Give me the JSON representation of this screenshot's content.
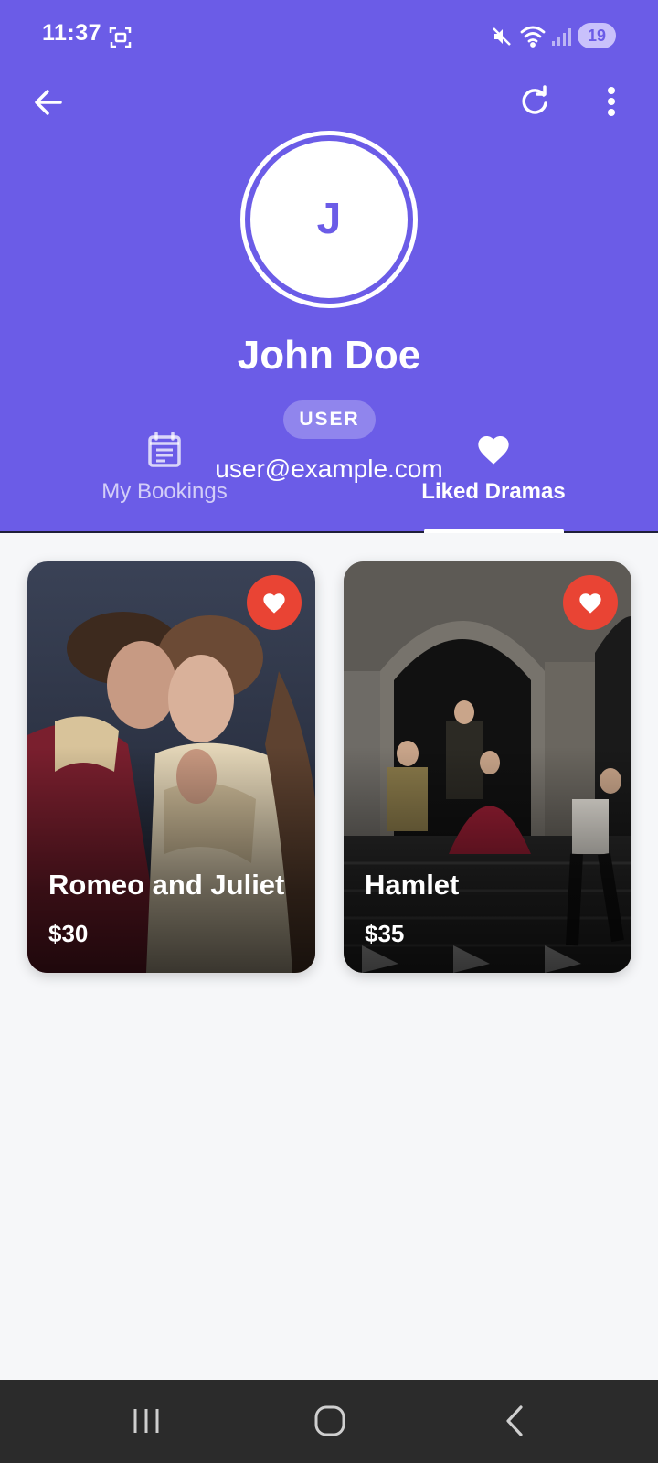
{
  "status_bar": {
    "time": "11:37",
    "battery": "19"
  },
  "profile": {
    "initial": "J",
    "name": "John Doe",
    "role": "USER",
    "email": "user@example.com"
  },
  "tabs": [
    {
      "label": "My Bookings",
      "icon": "calendar-icon",
      "selected": false
    },
    {
      "label": "Liked Dramas",
      "icon": "heart-icon",
      "selected": true
    }
  ],
  "dramas": [
    {
      "title": "Romeo and Juliet",
      "price": "$30",
      "liked": true
    },
    {
      "title": "Hamlet",
      "price": "$35",
      "liked": true
    }
  ],
  "colors": {
    "primary": "#6b5ce7",
    "like": "#e94434",
    "background": "#f6f7f9",
    "navbar": "#2b2b2b"
  }
}
